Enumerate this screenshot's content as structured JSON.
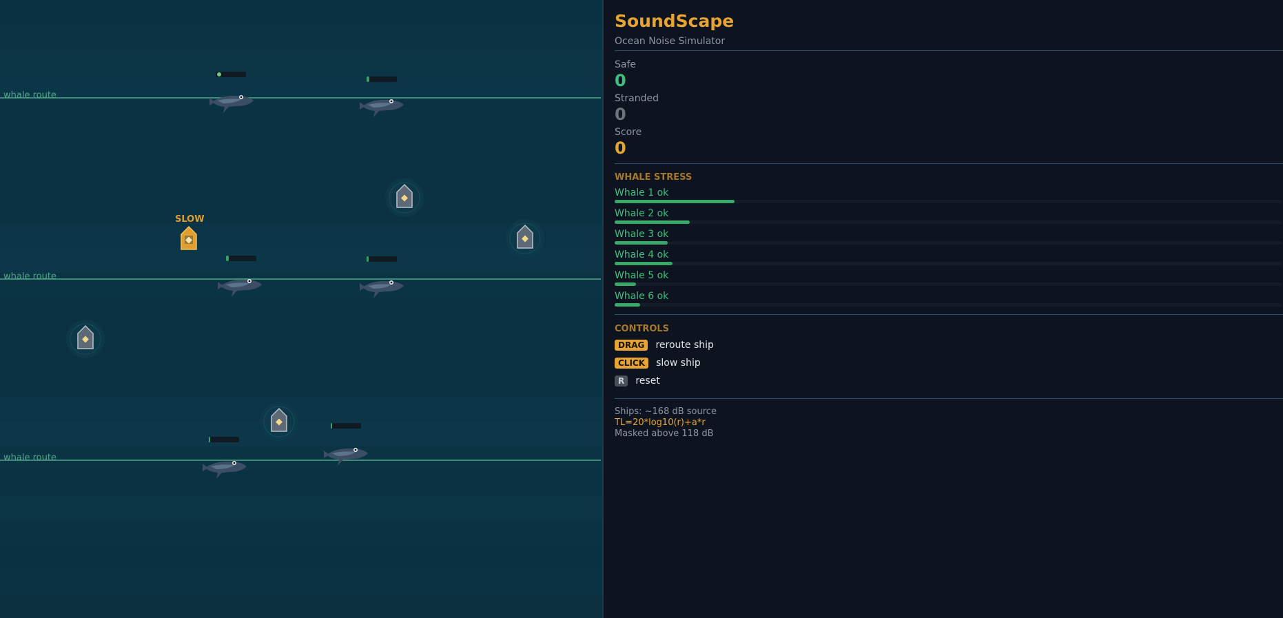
{
  "app": {
    "title": "SoundScape",
    "subtitle": "Ocean Noise Simulator"
  },
  "colors": {
    "accent": "#e6a532",
    "safe": "#3fbf7f",
    "ocean": "#0a3242",
    "route": "#4fa888"
  },
  "stats": {
    "safe_label": "Safe",
    "safe_value": "0",
    "stranded_label": "Stranded",
    "stranded_value": "0",
    "score_label": "Score",
    "score_value": "0"
  },
  "stress": {
    "heading": "WHALE STRESS",
    "whales": [
      {
        "label": "Whale 1  ok",
        "level": 0.18
      },
      {
        "label": "Whale 2  ok",
        "level": 0.113
      },
      {
        "label": "Whale 3  ok",
        "level": 0.08
      },
      {
        "label": "Whale 4  ok",
        "level": 0.087
      },
      {
        "label": "Whale 5  ok",
        "level": 0.032
      },
      {
        "label": "Whale 6  ok",
        "level": 0.038
      }
    ]
  },
  "controls": {
    "heading": "CONTROLS",
    "items": [
      {
        "key": "DRAG",
        "action": "reroute ship"
      },
      {
        "key": "CLICK",
        "action": "slow ship"
      },
      {
        "key": "R",
        "action": "reset"
      }
    ]
  },
  "notes": {
    "source": "Ships: ~168 dB source",
    "formula": "TL=20*log10(r)+a*r",
    "masked": "Masked above 118 dB"
  },
  "ocean": {
    "route_label": "whale route",
    "slow_label": "SLOW",
    "whale_stress_levels": [
      0.05,
      0.08,
      0.08,
      0.06,
      0.05,
      0.04
    ]
  }
}
